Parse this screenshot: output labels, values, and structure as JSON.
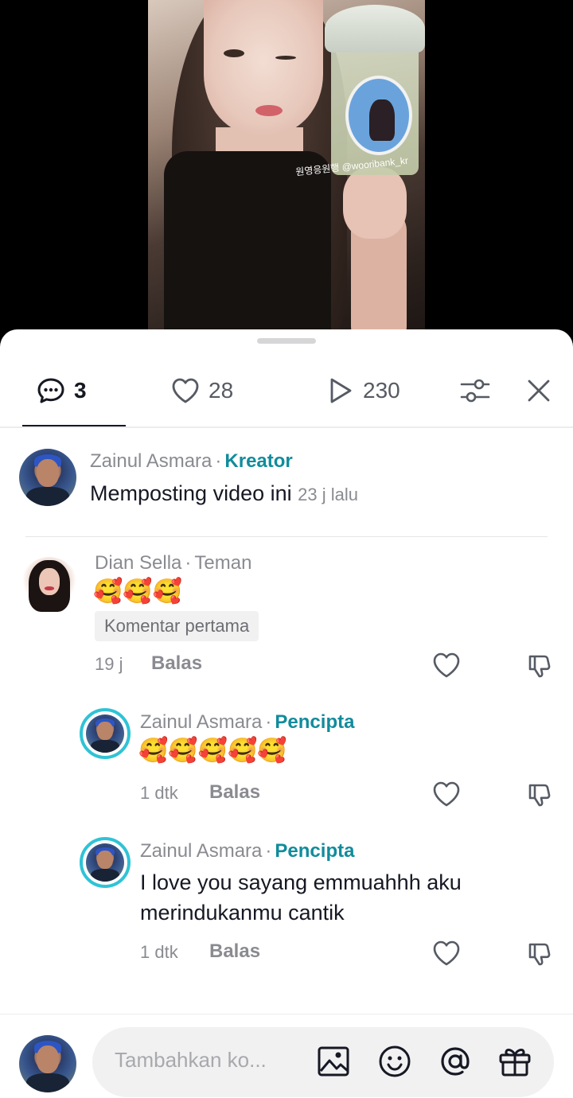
{
  "video": {
    "watermark": "원영응원행 @wooribank_kr"
  },
  "tabs": {
    "comments": {
      "count": "3"
    },
    "likes": {
      "count": "28"
    },
    "views": {
      "count": "230"
    }
  },
  "creator_post": {
    "name": "Zainul Asmara",
    "role": "Kreator",
    "text": "Memposting video ini",
    "time": "23 j lalu"
  },
  "comments": [
    {
      "name": "Dian Sella",
      "relation": "Teman",
      "text": "🥰🥰🥰",
      "badge": "Komentar pertama",
      "time": "19 j",
      "reply_label": "Balas"
    }
  ],
  "replies": [
    {
      "name": "Zainul Asmara",
      "role": "Pencipta",
      "text": "🥰🥰🥰🥰🥰",
      "time": "1 dtk",
      "reply_label": "Balas"
    },
    {
      "name": "Zainul Asmara",
      "role": "Pencipta",
      "text_line1": "I love you sayang emmuahhh aku",
      "text_line2": "merindukanmu cantik",
      "time": "1 dtk",
      "reply_label": "Balas"
    }
  ],
  "input": {
    "placeholder": "Tambahkan ko..."
  },
  "colors": {
    "accent": "#118c9c",
    "ring": "#2fc3d6"
  }
}
